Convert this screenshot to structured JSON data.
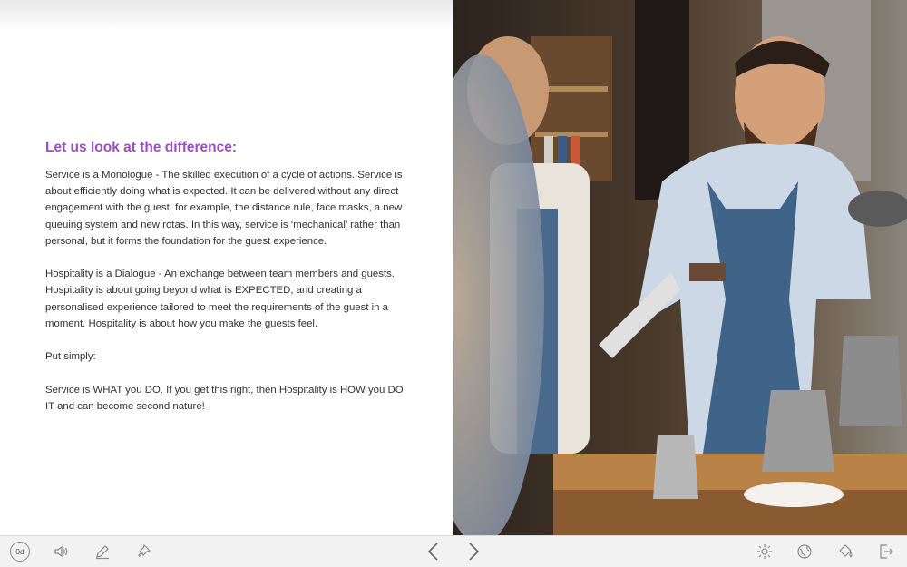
{
  "content": {
    "heading": "Let us look at the difference:",
    "paragraphs": [
      "Service is a Monologue - The skilled execution of a cycle of actions. Service is about efficiently doing what is expected. It can be delivered without any direct engagement with the guest, for example, the distance rule, face masks, a new queuing system and new rotas. In this way, service is ‘mechanical’ rather than personal, but it forms the foundation for the guest experience.",
      "Hospitality is a Dialogue - An exchange between team members and guests. Hospitality is about going beyond what is EXPECTED, and creating a personalised experience tailored to meet the requirements of the guest in a moment. Hospitality is about how you make the guests feel.",
      "Put simply:",
      "Service is WHAT you DO. If you get this right, then Hospitality is HOW you DO IT and can become second nature!"
    ]
  },
  "toolbar": {
    "timer": "0d",
    "left_icons": [
      "speaker-icon",
      "pencil-icon",
      "pin-icon"
    ],
    "nav_icons": [
      "chevron-left-icon",
      "chevron-right-icon"
    ],
    "right_icons": [
      "hotspot-icon",
      "globe-icon",
      "paint-bucket-icon",
      "exit-icon"
    ]
  },
  "colors": {
    "heading": "#9b4fc0",
    "body_text": "#333333",
    "toolbar_bg": "#f2f2f2",
    "icon": "#8a8a8a"
  }
}
